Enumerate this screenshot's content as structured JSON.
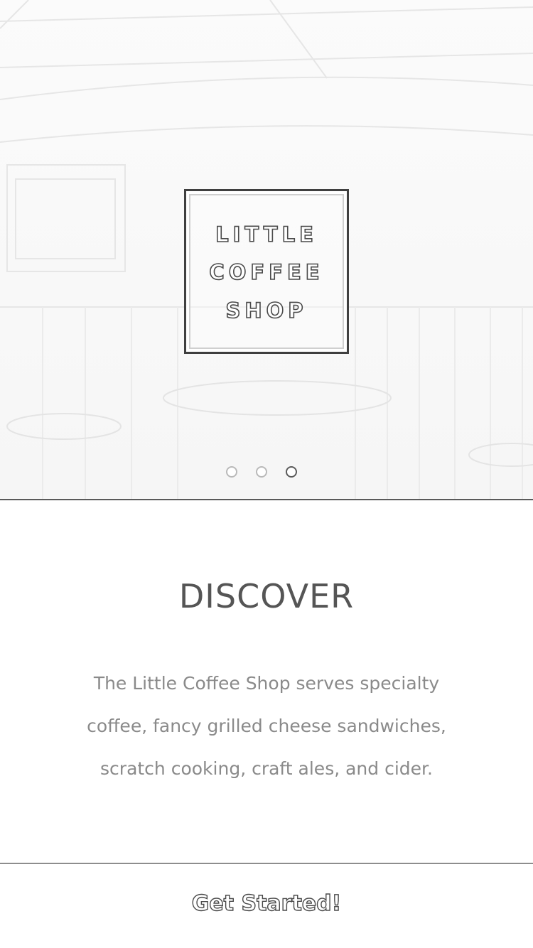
{
  "hero": {
    "logo_lines": [
      "LITTLE",
      "COFFEE",
      "SHOP"
    ],
    "carousel": {
      "total_slides": 3,
      "active_index": 2
    }
  },
  "content": {
    "heading": "DISCOVER",
    "body": "The Little Coffee Shop serves specialty coffee, fancy grilled cheese sandwiches, scratch cooking, craft ales, and cider."
  },
  "footer": {
    "cta_label": "Get Started!"
  }
}
